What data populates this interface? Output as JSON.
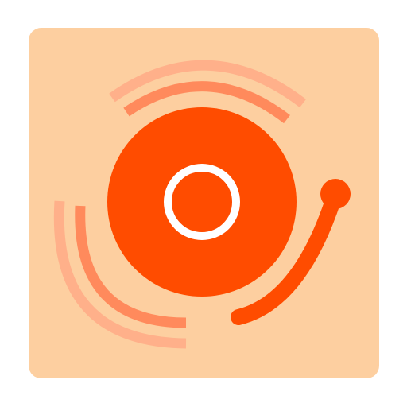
{
  "icon": {
    "name": "turntable-record-icon",
    "colors": {
      "background": "#FDCFA0",
      "record": "#FF4C00",
      "record_center_ring": "#FFFFFF",
      "tonearm": "#FF4C00",
      "wave_outer": "#FFB08A",
      "wave_inner": "#FF8A5C"
    }
  }
}
